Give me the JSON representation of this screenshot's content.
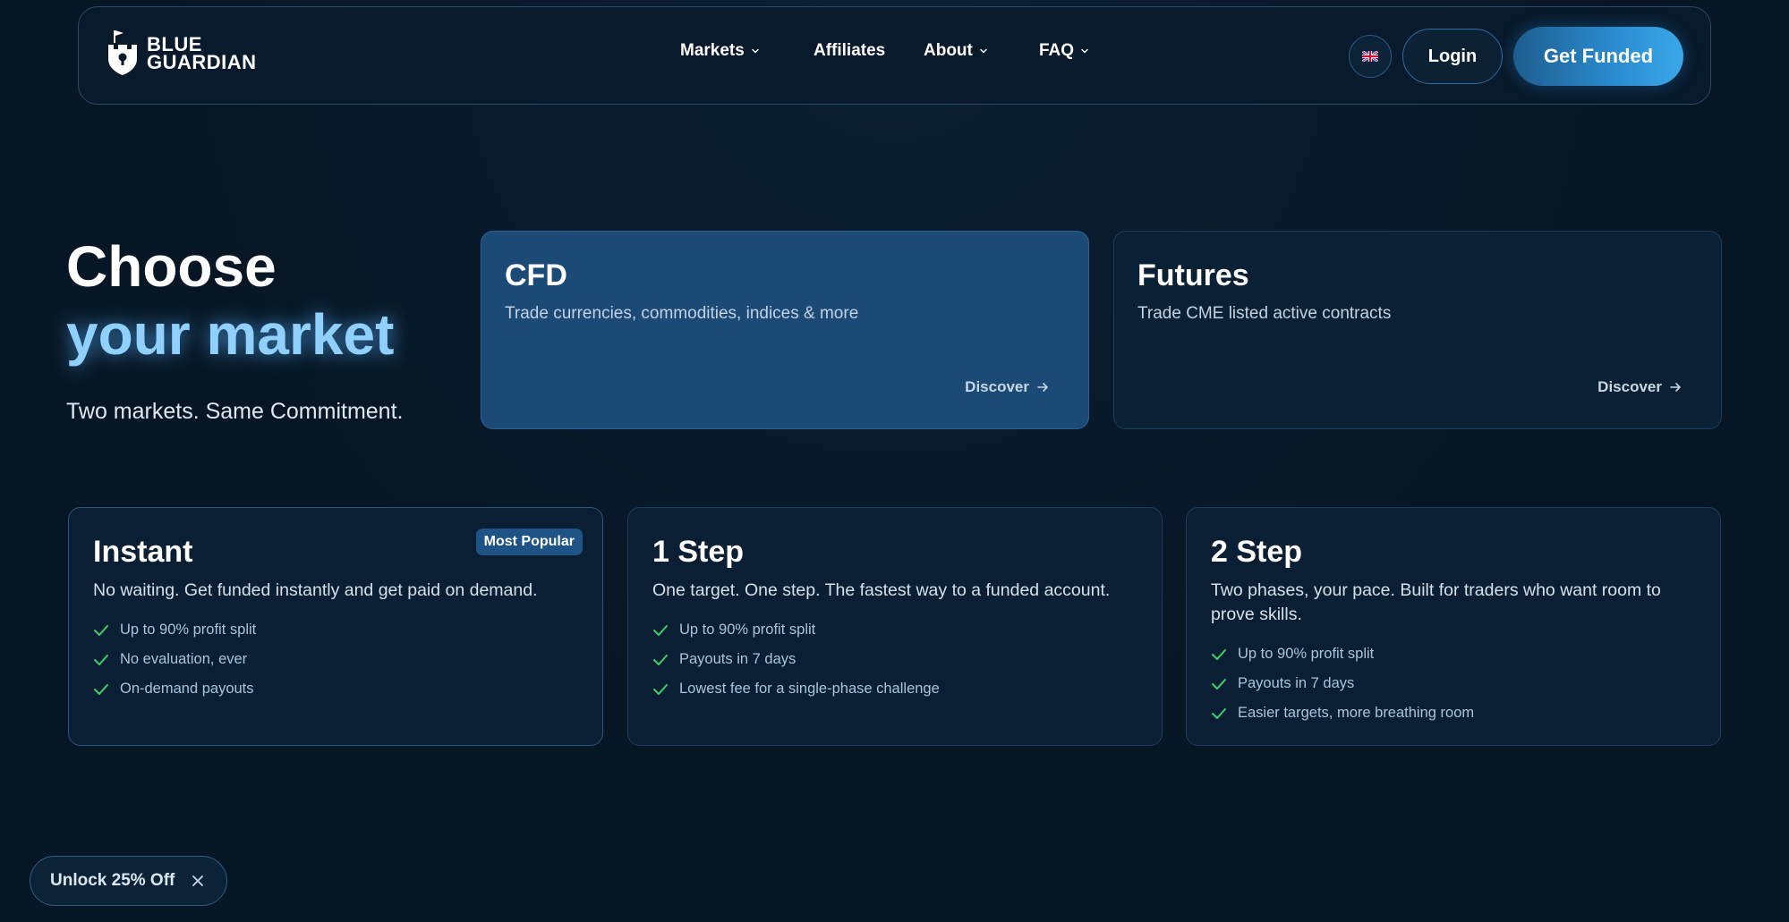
{
  "brand": {
    "line1": "BLUE",
    "line2": "GUARDIAN"
  },
  "nav": {
    "markets": "Markets",
    "affiliates": "Affiliates",
    "about": "About",
    "faq": "FAQ",
    "language_icon": "uk-flag-icon",
    "login": "Login",
    "get_funded": "Get Funded"
  },
  "hero": {
    "title_line1": "Choose",
    "title_line2": "your market",
    "subtitle": "Two markets. Same Commitment."
  },
  "markets": [
    {
      "title": "CFD",
      "description": "Trade currencies, commodities, indices & more",
      "cta": "Discover"
    },
    {
      "title": "Futures",
      "description": "Trade CME listed active contracts",
      "cta": "Discover"
    }
  ],
  "plans": [
    {
      "title": "Instant",
      "badge": "Most Popular",
      "description": "No waiting. Get funded instantly and get paid on demand.",
      "features": [
        "Up to 90% profit split",
        "No evaluation, ever",
        "On-demand payouts"
      ]
    },
    {
      "title": "1 Step",
      "description": "One target. One step. The fastest way to a funded account.",
      "features": [
        "Up to 90% profit split",
        "Payouts in 7 days",
        "Lowest fee for a single-phase challenge"
      ]
    },
    {
      "title": "2 Step",
      "description": "Two phases, your pace. Built for traders who want room to prove skills.",
      "features": [
        "Up to 90% profit split",
        "Payouts in 7 days",
        "Easier targets, more breathing room"
      ]
    }
  ],
  "promo": {
    "label": "Unlock 25% Off"
  },
  "colors": {
    "background": "#071624",
    "accent": "#2a8cd0",
    "highlight_text": "#8fd0ff",
    "check": "#3fcf6a"
  }
}
